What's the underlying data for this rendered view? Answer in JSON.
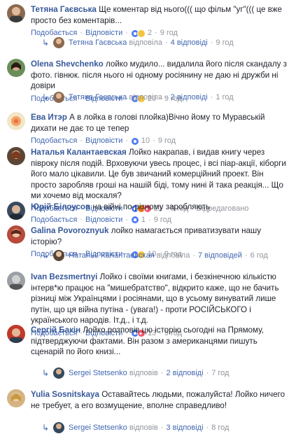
{
  "labels": {
    "like": "Подобається",
    "reply": "Відповісти",
    "sep": "·",
    "replied": "відповіла",
    "replied_m": "відповів",
    "edited": "Відредаговано"
  },
  "comments": [
    {
      "author": "Тетяна Гаєвська",
      "text": "Ще коментар від нього((( що фільм \"уг\"((( це вже просто без коментарів...",
      "reactions": "2",
      "time": "9 год",
      "edited": "",
      "reply": {
        "author": "Тетяна Гаєвська",
        "verb": "відповіла",
        "count": "4 відповіді",
        "time": "9 год"
      }
    },
    {
      "author": "Olena Shevchenko",
      "text": "лойко мудило... видалила його після скандалу з фото. гівнюк. після нього ні одному росіянину не даю ні дружби ні довіри",
      "reactions": "20",
      "time": "9 год",
      "edited": "",
      "reply": {
        "author": "Тетяна Гаєвська",
        "verb": "відповіла",
        "count": "2 відповіді",
        "time": "1 год"
      }
    },
    {
      "author": "Ева Итэр",
      "text": "А в лойка в голові плойка)Вічно йому то Муравській дихати не дає то це тепер",
      "reactions": "10",
      "time": "9 год",
      "edited": ""
    },
    {
      "author": "Наталья Калантаевская",
      "text": "Лойко накрапав, і видав книгу через півроку після подій. Врховуючи увесь процес, і всі піар-акції, кіборги його мало цікавили. Це був звичаний комерційний проект. Він просто заробляв гроші на нашій біді, тому нині й така реакція... Що ми хочемо від москаля?",
      "reactions": "21",
      "time": "9 год",
      "edited": "Відредаговано"
    },
    {
      "author": "Юрій Білоусов",
      "text": "на війні по-різному заробляють",
      "reactions": "1",
      "time": "9 год",
      "edited": ""
    },
    {
      "author": "Galina Povoroznyuk",
      "text": "лойко намагається приватизувати нашу історію?",
      "reactions": "10",
      "time": "9 год",
      "edited": "",
      "reply": {
        "author": "Наталья Калантаевская",
        "verb": "відповіла",
        "count": "7 відповідей",
        "time": "6 год"
      }
    },
    {
      "author": "Ivan Bezsmertnyi",
      "text": "Лойко і своїми книгами, і безкінечною кількістю інтерв*ю працює на \"мишебратство\", відкрито каже, що не бачить різниці між Українцями і росіянами, що в усьому винуватий лише путін, що ця війна путіна - (увага!) - проти РОСІЙСЬКОГО і українського народів. Іт.д., і т.д.",
      "reactions": "13",
      "time": "9 год",
      "edited": ""
    },
    {
      "author": "Сергій Бакін",
      "text": "Лойко розповів цю історію сьогодні на Прямому, підтверджуючи фактами. Він разом з американцями пишуть сценарій по його книзі...",
      "reactions": "",
      "time": "",
      "edited": "",
      "reply": {
        "author": "Sergei Stetsenko",
        "verb": "відповів",
        "count": "2 відповіді",
        "time": "7 год"
      }
    },
    {
      "author": "Yulia Sosnitskaya",
      "text": "Оставайтесь людьми, пожалуйста! Лойко ничего не требует, а его возмущение, вполне справедливо!",
      "reactions": "",
      "time": "",
      "edited": "",
      "reply": {
        "author": "Sergei Stetsenko",
        "verb": "відповів",
        "count": "3 відповіді",
        "time": "8 год"
      }
    }
  ]
}
